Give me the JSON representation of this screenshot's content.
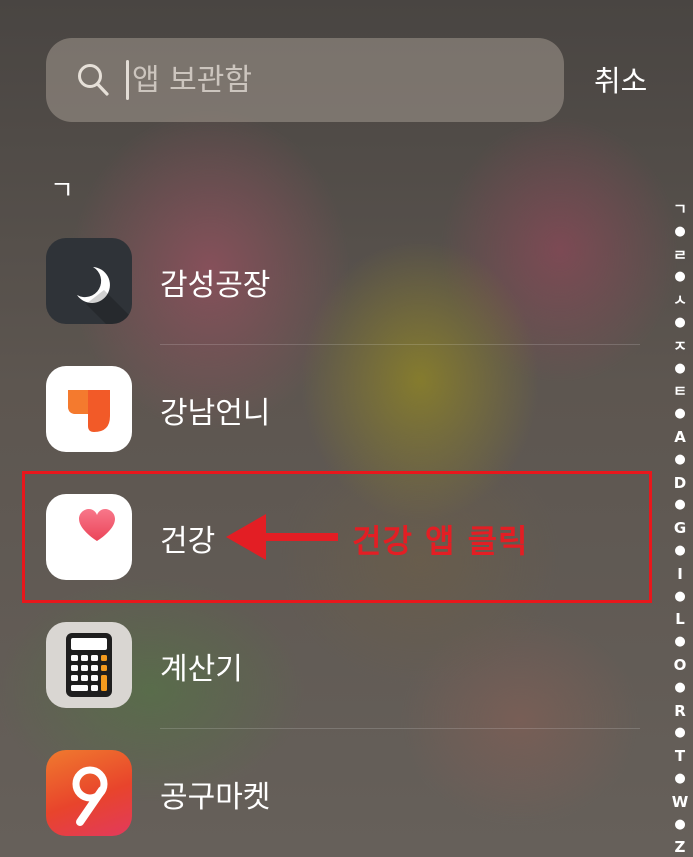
{
  "search": {
    "placeholder": "앱 보관함",
    "cancel_label": "취소"
  },
  "section_header": "ㄱ",
  "apps": [
    {
      "name": "감성공장",
      "icon": "moon-icon"
    },
    {
      "name": "강남언니",
      "icon": "orange-heart-icon"
    },
    {
      "name": "건강",
      "icon": "health-heart-icon"
    },
    {
      "name": "계산기",
      "icon": "calculator-icon"
    },
    {
      "name": "공구마켓",
      "icon": "gonggu-9-icon"
    }
  ],
  "index_bar": [
    "ㄱ",
    "●",
    "ㄹ",
    "●",
    "ㅅ",
    "●",
    "ㅈ",
    "●",
    "ㅌ",
    "●",
    "A",
    "●",
    "D",
    "●",
    "G",
    "●",
    "I",
    "●",
    "L",
    "●",
    "O",
    "●",
    "R",
    "●",
    "T",
    "●",
    "W",
    "●",
    "Z",
    "#"
  ],
  "annotation": {
    "text": "건강 앱 클릭",
    "color": "#e31e24"
  },
  "colors": {
    "highlight": "#e8171c",
    "annotation": "#e31e24",
    "health_heart": "#ef5a6a",
    "gangnam_orange": "#f25a28",
    "gonggu_red": "#e8442c"
  }
}
